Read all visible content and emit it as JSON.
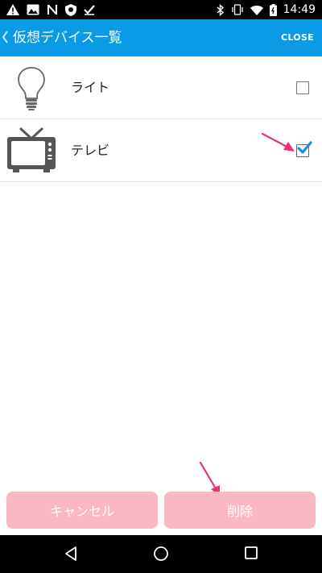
{
  "status_bar": {
    "time": "14:49",
    "left_icons": [
      "warning-icon",
      "photo-icon",
      "n-icon",
      "shield-icon",
      "check-icon"
    ],
    "right_icons": [
      "bluetooth-icon",
      "vibrate-icon",
      "wifi-icon",
      "battery-icon"
    ]
  },
  "app_bar": {
    "title": "仮想デバイス一覧",
    "close_label": "CLOSE",
    "color": "#0a9ae6"
  },
  "devices": [
    {
      "label": "ライト",
      "icon": "lightbulb-icon",
      "checked": false
    },
    {
      "label": "テレビ",
      "icon": "tv-icon",
      "checked": true
    }
  ],
  "buttons": {
    "cancel_label": "キャンセル",
    "delete_label": "削除",
    "color": "#fab7c4"
  },
  "annotation_color": "#e8336e",
  "nav_bar": {
    "icons": [
      "back-icon",
      "home-icon",
      "recents-icon"
    ]
  }
}
